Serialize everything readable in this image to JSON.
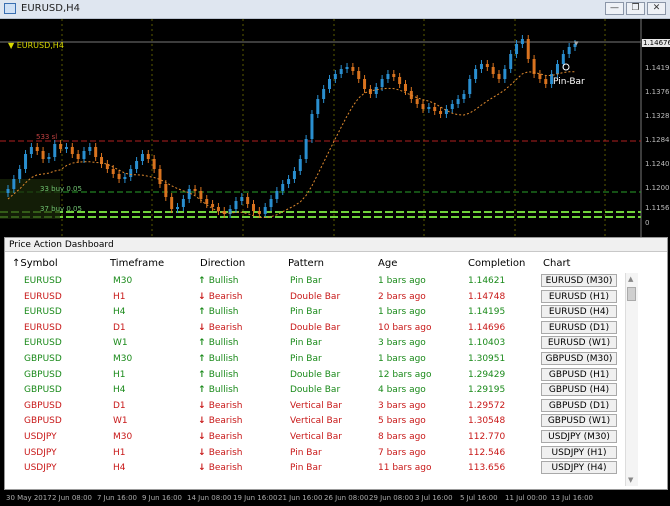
{
  "window": {
    "title": "EURUSD,H4",
    "buttons": {
      "minimize": "—",
      "restore": "❐",
      "close": "✕"
    }
  },
  "chart": {
    "symbol_label": "EURUSD,H4",
    "current_price": "1.14676",
    "price_ticks": [
      "1.1419",
      "1.13760",
      "1.1328",
      "1.12840",
      "1.1240",
      "1.12000",
      "1.1156",
      "0"
    ],
    "levels": [
      {
        "label": "533 sl",
        "color": "#b02020"
      },
      {
        "label": "33 buy 0.05",
        "color": "#2aa02a"
      },
      {
        "label": "37 buy 0.05",
        "color": "#2aa02a"
      }
    ],
    "annotation": "Pin-Bar",
    "time_ticks": [
      "30 May 2017",
      "2 Jun 08:00",
      "7 Jun 16:00",
      "9 Jun 16:00",
      "14 Jun 08:00",
      "19 Jun 16:00",
      "21 Jun 16:00",
      "26 Jun 08:00",
      "29 Jun 08:00",
      "3 Jul 16:00",
      "5 Jul 16:00",
      "11 Jul 00:00",
      "13 Jul 16:00"
    ],
    "colors": {
      "bull": "#2a8fd0",
      "bear": "#d9731f",
      "ma": "#e08a2e",
      "grid": "#5a5a00"
    }
  },
  "dashboard": {
    "title": "Price Action Dashboard",
    "headers": {
      "symbol": "↑Symbol",
      "timeframe": "Timeframe",
      "direction": "Direction",
      "pattern": "Pattern",
      "age": "Age",
      "completion": "Completion",
      "chart": "Chart"
    },
    "rows": [
      {
        "symbol": "EURUSD",
        "tf": "M30",
        "dir": "Bullish",
        "pattern": "Pin Bar",
        "age": "1 bars ago",
        "completion": "1.14621",
        "chart": "EURUSD (M30)",
        "bull": true
      },
      {
        "symbol": "EURUSD",
        "tf": "H1",
        "dir": "Bearish",
        "pattern": "Double Bar",
        "age": "2 bars ago",
        "completion": "1.14748",
        "chart": "EURUSD (H1)",
        "bull": false
      },
      {
        "symbol": "EURUSD",
        "tf": "H4",
        "dir": "Bullish",
        "pattern": "Pin Bar",
        "age": "1 bars ago",
        "completion": "1.14195",
        "chart": "EURUSD (H4)",
        "bull": true
      },
      {
        "symbol": "EURUSD",
        "tf": "D1",
        "dir": "Bearish",
        "pattern": "Double Bar",
        "age": "10 bars ago",
        "completion": "1.14696",
        "chart": "EURUSD (D1)",
        "bull": false
      },
      {
        "symbol": "EURUSD",
        "tf": "W1",
        "dir": "Bullish",
        "pattern": "Pin Bar",
        "age": "3 bars ago",
        "completion": "1.10403",
        "chart": "EURUSD (W1)",
        "bull": true
      },
      {
        "symbol": "GBPUSD",
        "tf": "M30",
        "dir": "Bullish",
        "pattern": "Pin Bar",
        "age": "1 bars ago",
        "completion": "1.30951",
        "chart": "GBPUSD (M30)",
        "bull": true
      },
      {
        "symbol": "GBPUSD",
        "tf": "H1",
        "dir": "Bullish",
        "pattern": "Double Bar",
        "age": "12 bars ago",
        "completion": "1.29429",
        "chart": "GBPUSD (H1)",
        "bull": true
      },
      {
        "symbol": "GBPUSD",
        "tf": "H4",
        "dir": "Bullish",
        "pattern": "Double Bar",
        "age": "4 bars ago",
        "completion": "1.29195",
        "chart": "GBPUSD (H4)",
        "bull": true
      },
      {
        "symbol": "GBPUSD",
        "tf": "D1",
        "dir": "Bearish",
        "pattern": "Vertical Bar",
        "age": "3 bars ago",
        "completion": "1.29572",
        "chart": "GBPUSD (D1)",
        "bull": false
      },
      {
        "symbol": "GBPUSD",
        "tf": "W1",
        "dir": "Bearish",
        "pattern": "Vertical Bar",
        "age": "5 bars ago",
        "completion": "1.30548",
        "chart": "GBPUSD (W1)",
        "bull": false
      },
      {
        "symbol": "USDJPY",
        "tf": "M30",
        "dir": "Bearish",
        "pattern": "Vertical Bar",
        "age": "8 bars ago",
        "completion": "112.770",
        "chart": "USDJPY (M30)",
        "bull": false
      },
      {
        "symbol": "USDJPY",
        "tf": "H1",
        "dir": "Bearish",
        "pattern": "Pin Bar",
        "age": "7 bars ago",
        "completion": "112.546",
        "chart": "USDJPY (H1)",
        "bull": false
      },
      {
        "symbol": "USDJPY",
        "tf": "H4",
        "dir": "Bearish",
        "pattern": "Pin Bar",
        "age": "11 bars ago",
        "completion": "113.656",
        "chart": "USDJPY (H4)",
        "bull": false
      }
    ]
  }
}
